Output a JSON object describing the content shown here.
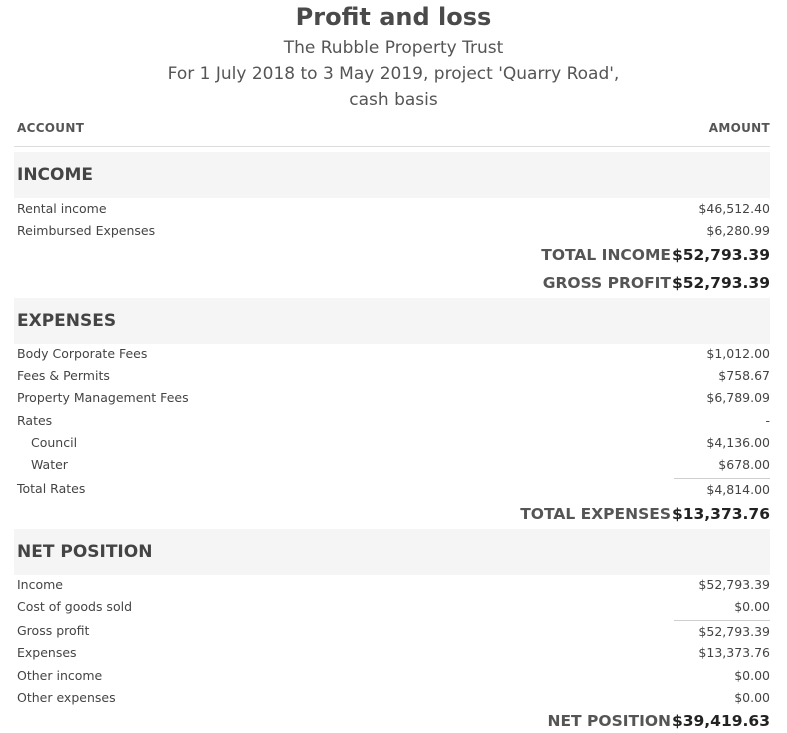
{
  "report": {
    "title": "Profit and loss",
    "company": "The Rubble Property Trust",
    "period_line1": "For 1 July 2018 to 3 May 2019, project 'Quarry Road',",
    "period_line2": "cash basis"
  },
  "columns": {
    "account": "ACCOUNT",
    "amount": "AMOUNT"
  },
  "income": {
    "heading": "INCOME",
    "rows": [
      {
        "label": "Rental income",
        "value": "$46,512.40"
      },
      {
        "label": "Reimbursed Expenses",
        "value": "$6,280.99"
      }
    ],
    "total_label": "TOTAL INCOME",
    "total_value": "$52,793.39",
    "gross_profit_label": "GROSS PROFIT",
    "gross_profit_value": "$52,793.39"
  },
  "expenses": {
    "heading": "EXPENSES",
    "rows": [
      {
        "label": "Body Corporate Fees",
        "value": "$1,012.00"
      },
      {
        "label": "Fees & Permits",
        "value": "$758.67"
      },
      {
        "label": "Property Management Fees",
        "value": "$6,789.09"
      },
      {
        "label": "Rates",
        "value": "-"
      },
      {
        "label": "Council",
        "value": "$4,136.00"
      },
      {
        "label": "Water",
        "value": "$678.00"
      },
      {
        "label": "Total Rates",
        "value": "$4,814.00"
      }
    ],
    "total_label": "TOTAL EXPENSES",
    "total_value": "$13,373.76"
  },
  "net_position": {
    "heading": "NET POSITION",
    "rows": [
      {
        "label": "Income",
        "value": "$52,793.39"
      },
      {
        "label": "Cost of goods sold",
        "value": "$0.00"
      },
      {
        "label": "Gross profit",
        "value": "$52,793.39"
      },
      {
        "label": "Expenses",
        "value": "$13,373.76"
      },
      {
        "label": "Other income",
        "value": "$0.00"
      },
      {
        "label": "Other expenses",
        "value": "$0.00"
      }
    ],
    "total_label": "NET POSITION",
    "total_value": "$39,419.63"
  }
}
